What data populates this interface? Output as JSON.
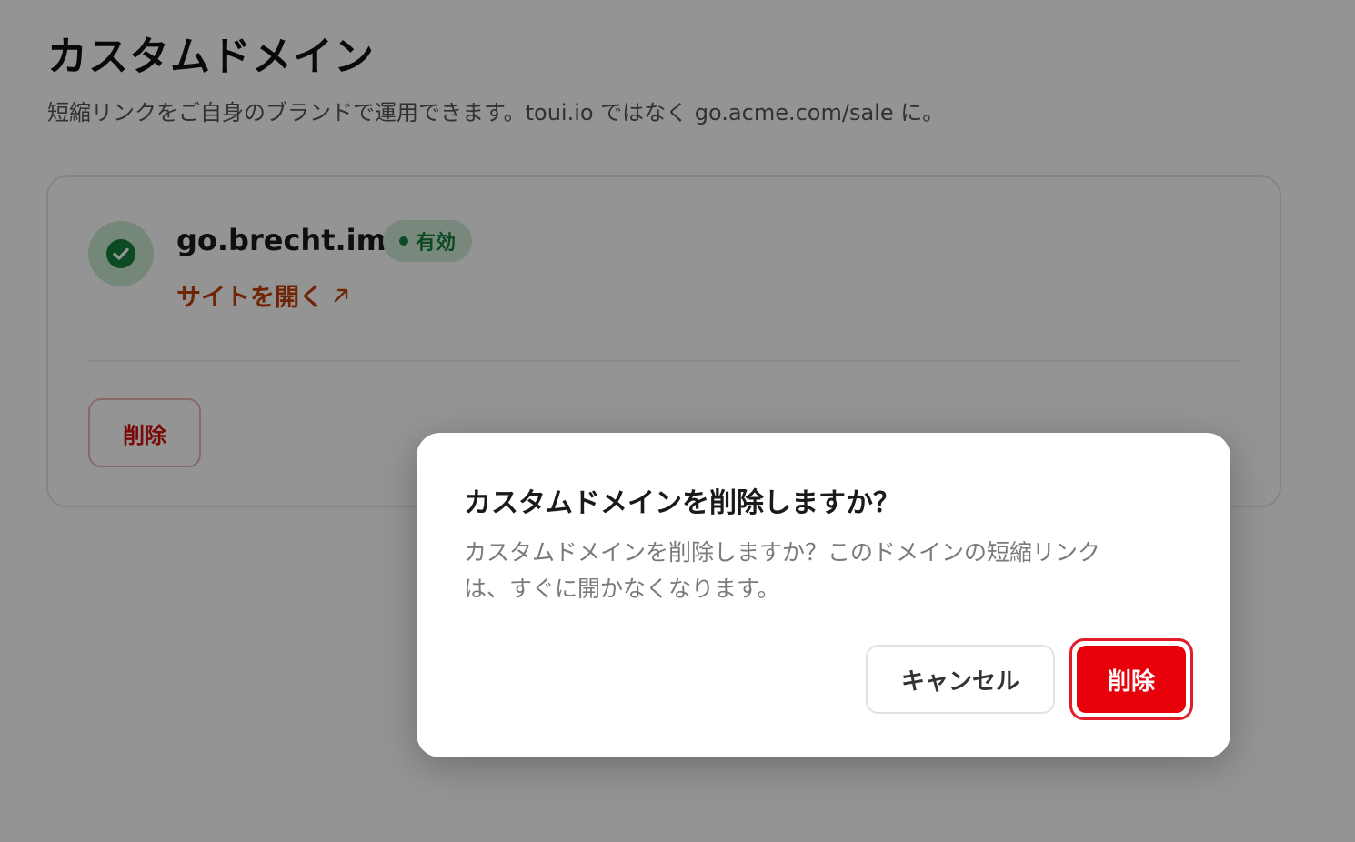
{
  "page": {
    "title": "カスタムドメイン",
    "description": "短縮リンクをご自身のブランドで運用できます。toui.io ではなく go.acme.com/sale に。"
  },
  "domain_card": {
    "status_icon": "check-circle-icon",
    "domain": "go.brecht.im",
    "badge": "有効",
    "visit_link": "サイトを開く",
    "visit_icon": "arrow-up-right-icon",
    "delete_label": "削除"
  },
  "modal": {
    "title": "カスタムドメインを削除しますか？",
    "body_line1": "カスタムドメインを削除しますか？このドメインの短縮リンク",
    "body_line2": "は、すぐに開かなくなります。",
    "cancel_label": "キャンセル",
    "confirm_label": "削除"
  },
  "colors": {
    "success_green": "#14803c",
    "link_orange": "#c2410c",
    "danger_red": "#e8000b"
  }
}
